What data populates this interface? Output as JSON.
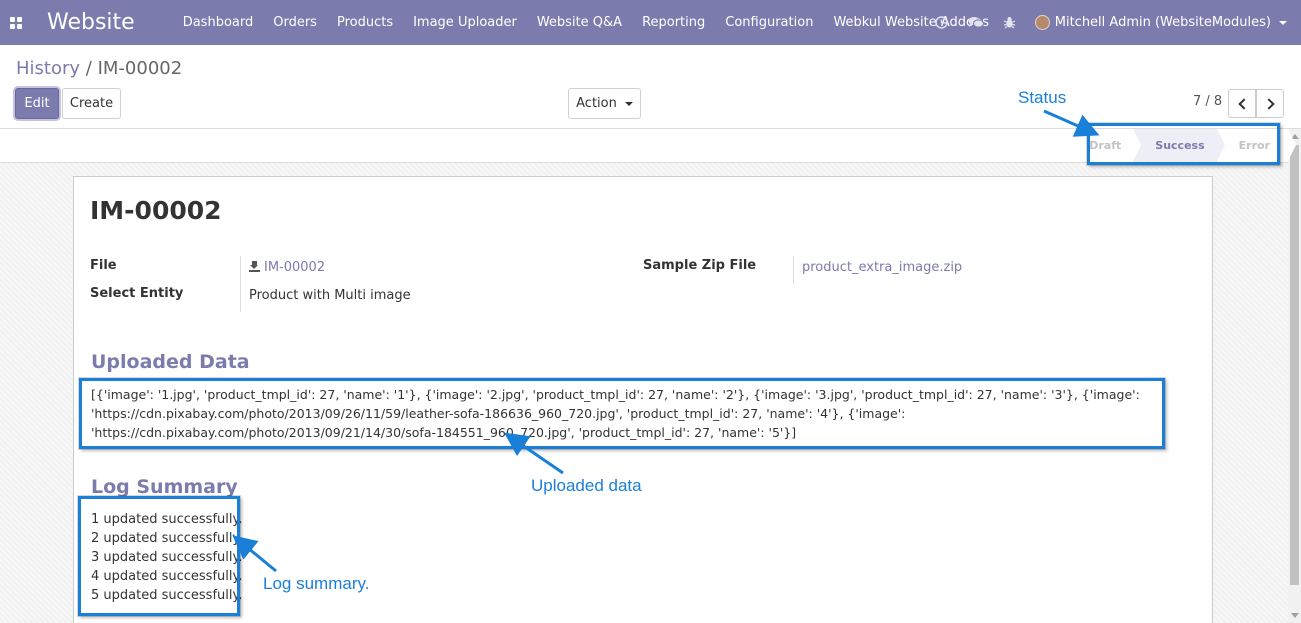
{
  "navbar": {
    "brand": "Website",
    "menu": [
      "Dashboard",
      "Orders",
      "Products",
      "Image Uploader",
      "Website Q&A",
      "Reporting",
      "Configuration",
      "Webkul Website Addons"
    ],
    "icons": [
      "clock-icon",
      "chat-icon",
      "bug-icon"
    ],
    "user": "Mitchell Admin (WebsiteModules)"
  },
  "breadcrumb": {
    "parent": "History",
    "separator": "/",
    "current": "IM-00002"
  },
  "buttons": {
    "edit": "Edit",
    "create": "Create",
    "action": "Action"
  },
  "pager": {
    "value": "7 / 8"
  },
  "status": {
    "steps": [
      "Draft",
      "Success",
      "Error"
    ],
    "active": "Success"
  },
  "record": {
    "title": "IM-00002",
    "file_label": "File",
    "file_value": "IM-00002",
    "entity_label": "Select Entity",
    "entity_value": "Product with Multi image",
    "sample_label": "Sample Zip File",
    "sample_value": "product_extra_image.zip"
  },
  "uploaded": {
    "title": "Uploaded Data",
    "text": "[{'image': '1.jpg', 'product_tmpl_id': 27, 'name': '1'}, {'image': '2.jpg', 'product_tmpl_id': 27, 'name': '2'}, {'image': '3.jpg', 'product_tmpl_id': 27, 'name': '3'}, {'image': 'https://cdn.pixabay.com/photo/2013/09/26/11/59/leather-sofa-186636_960_720.jpg', 'product_tmpl_id': 27, 'name': '4'}, {'image': 'https://cdn.pixabay.com/photo/2013/09/21/14/30/sofa-184551_960_720.jpg', 'product_tmpl_id': 27, 'name': '5'}]"
  },
  "log": {
    "title": "Log Summary",
    "lines": [
      "1 updated successfully.",
      "2 updated successfully.",
      "3 updated successfully.",
      "4 updated successfully.",
      "5 updated successfully."
    ]
  },
  "annotations": {
    "status": "Status",
    "uploaded": "Uploaded data",
    "log": "Log summary."
  },
  "colors": {
    "primary": "#7c7bad",
    "annotation": "#1a7fd9"
  }
}
